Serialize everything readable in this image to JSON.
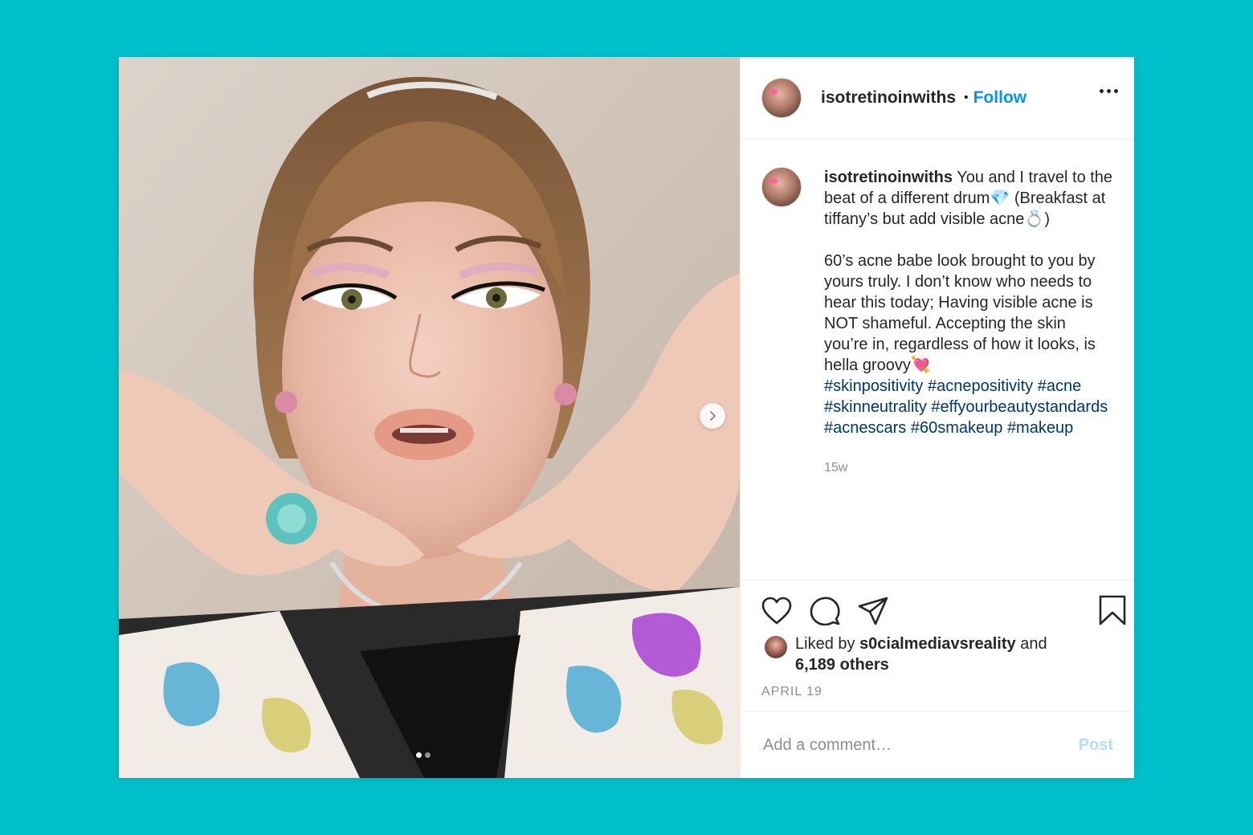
{
  "post": {
    "username": "isotretinoinwiths",
    "separator": "•",
    "follow_label": "Follow",
    "caption": {
      "line1": "You and I travel to the beat of a different drum💎 (Breakfast at tiffany’s but add visible acne💍)",
      "line2": "60’s acne babe look brought to you by yours truly. I don’t know who needs to hear this today; Having visible acne is NOT shameful. Accepting the skin you’re in, regardless of how it looks, is hella groovy💘",
      "hashtags": [
        "#skinpositivity",
        "#acnepositivity",
        "#acne",
        "#skinneutrality",
        "#effyourbeautystandards",
        "#acnescars",
        "#60smakeup",
        "#makeup"
      ]
    },
    "time_ago": "15w",
    "liked_by": {
      "prefix": "Liked by",
      "user": "s0cialmediavsreality",
      "conjunction": "and",
      "others": "6,189 others"
    },
    "date": "APRIL 19",
    "comment_placeholder": "Add a comment…",
    "post_label": "Post"
  },
  "carousel": {
    "current": 1,
    "total": 2
  },
  "icons": {
    "like": "heart-icon",
    "comment": "comment-icon",
    "share": "share-icon",
    "save": "bookmark-icon",
    "more": "more-options-icon",
    "next": "chevron-right-icon"
  },
  "colors": {
    "background": "#00c1cb",
    "follow": "#0095f6",
    "hashtag": "#00376b",
    "muted": "#8e8e8e",
    "post_disabled": "#b2dffc"
  }
}
